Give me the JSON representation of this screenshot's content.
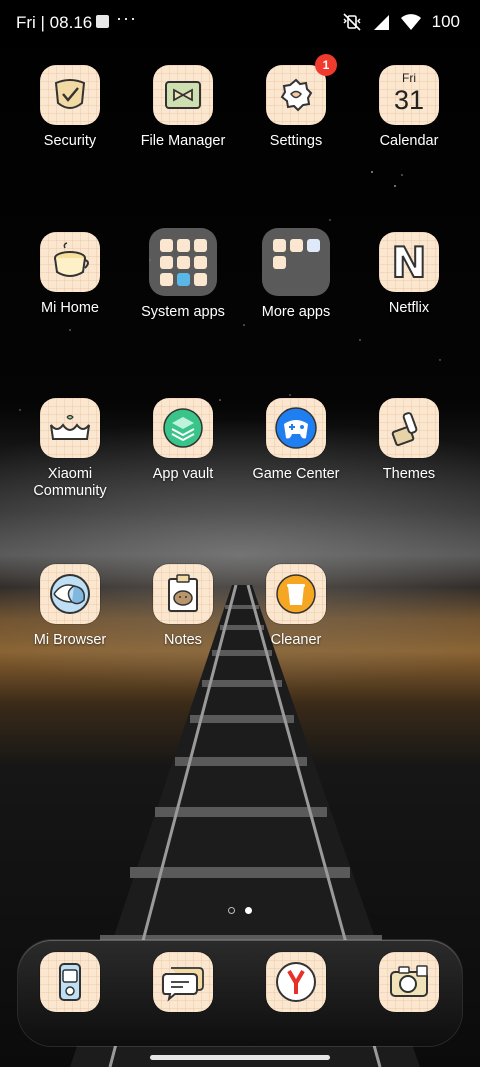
{
  "status_bar": {
    "time": "Fri | 08.16",
    "more": "···",
    "battery": "100",
    "icons": [
      "notification-square-icon",
      "muted-vibrate-icon",
      "cell-signal-icon",
      "wifi-icon"
    ]
  },
  "apps": [
    {
      "label": "Security",
      "icon": "security-icon"
    },
    {
      "label": "File Manager",
      "icon": "file-manager-icon"
    },
    {
      "label": "Settings",
      "icon": "gear-icon",
      "badge": "1"
    },
    {
      "label": "Calendar",
      "icon": "calendar-icon",
      "day": "Fri",
      "date": "31"
    },
    {
      "label": "Mi Home",
      "icon": "mi-home-icon"
    },
    {
      "label": "System apps",
      "icon": "folder-icon"
    },
    {
      "label": "More apps",
      "icon": "folder-icon"
    },
    {
      "label": "Netflix",
      "icon": "netflix-icon",
      "glyph": "N"
    },
    {
      "label": "Xiaomi Community",
      "icon": "community-crown-icon"
    },
    {
      "label": "App vault",
      "icon": "app-vault-icon"
    },
    {
      "label": "Game Center",
      "icon": "game-center-icon"
    },
    {
      "label": "Themes",
      "icon": "themes-brush-icon"
    },
    {
      "label": "Mi Browser",
      "icon": "browser-icon"
    },
    {
      "label": "Notes",
      "icon": "notes-icon"
    },
    {
      "label": "Cleaner",
      "icon": "cleaner-icon"
    }
  ],
  "dock": [
    {
      "icon": "phone-icon"
    },
    {
      "icon": "messages-icon"
    },
    {
      "icon": "yandex-browser-icon"
    },
    {
      "icon": "camera-icon"
    }
  ],
  "pages": {
    "count": 2,
    "current": 2
  },
  "colors": {
    "tile": "#fbe7cf",
    "badge": "#f03a2e"
  }
}
